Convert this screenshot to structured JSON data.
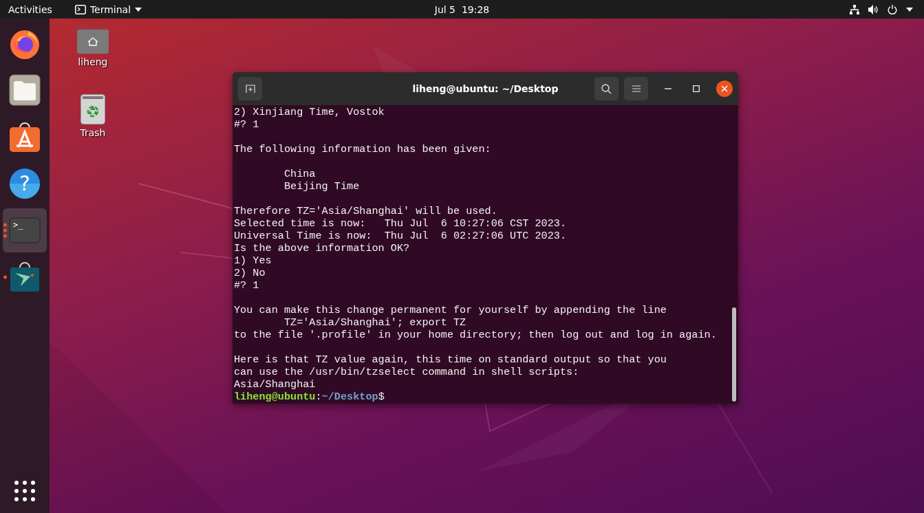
{
  "top_bar": {
    "activities": "Activities",
    "app_menu": "Terminal",
    "clock": "Jul 5  19:28"
  },
  "dock": {
    "items": [
      {
        "kind": "firefox",
        "running": false,
        "focused": false
      },
      {
        "kind": "files",
        "running": false,
        "focused": false
      },
      {
        "kind": "software",
        "running": false,
        "focused": false
      },
      {
        "kind": "help",
        "glyph": "?",
        "running": false,
        "focused": false
      },
      {
        "kind": "terminal",
        "glyph": ">_",
        "running": true,
        "focused": true
      },
      {
        "kind": "store",
        "running": true,
        "focused": false
      }
    ]
  },
  "desktop_icons": [
    {
      "kind": "home",
      "label": "liheng"
    },
    {
      "kind": "trash",
      "label": "Trash"
    }
  ],
  "terminal": {
    "title": "liheng@ubuntu: ~/Desktop",
    "blocks": [
      {
        "lines": [
          "2) Xinjiang Time, Vostok",
          "#? 1"
        ]
      },
      {
        "lines": [
          "The following information has been given:"
        ]
      },
      {
        "lines": [
          "        China",
          "        Beijing Time"
        ]
      },
      {
        "lines": [
          "Therefore TZ='Asia/Shanghai' will be used.",
          "Selected time is now:   Thu Jul  6 10:27:06 CST 2023.",
          "Universal Time is now:  Thu Jul  6 02:27:06 UTC 2023.",
          "Is the above information OK?",
          "1) Yes",
          "2) No",
          "#? 1"
        ]
      },
      {
        "lines": [
          "You can make this change permanent for yourself by appending the line",
          "        TZ='Asia/Shanghai'; export TZ",
          "to the file '.profile' in your home directory; then log out and log in again."
        ]
      },
      {
        "lines": [
          "Here is that TZ value again, this time on standard output so that you",
          "can use the /usr/bin/tzselect command in shell scripts:",
          "Asia/Shanghai"
        ]
      }
    ],
    "prompt": {
      "user_host": "liheng@ubuntu",
      "separator": ":",
      "path": "~/Desktop",
      "symbol": "$"
    }
  }
}
